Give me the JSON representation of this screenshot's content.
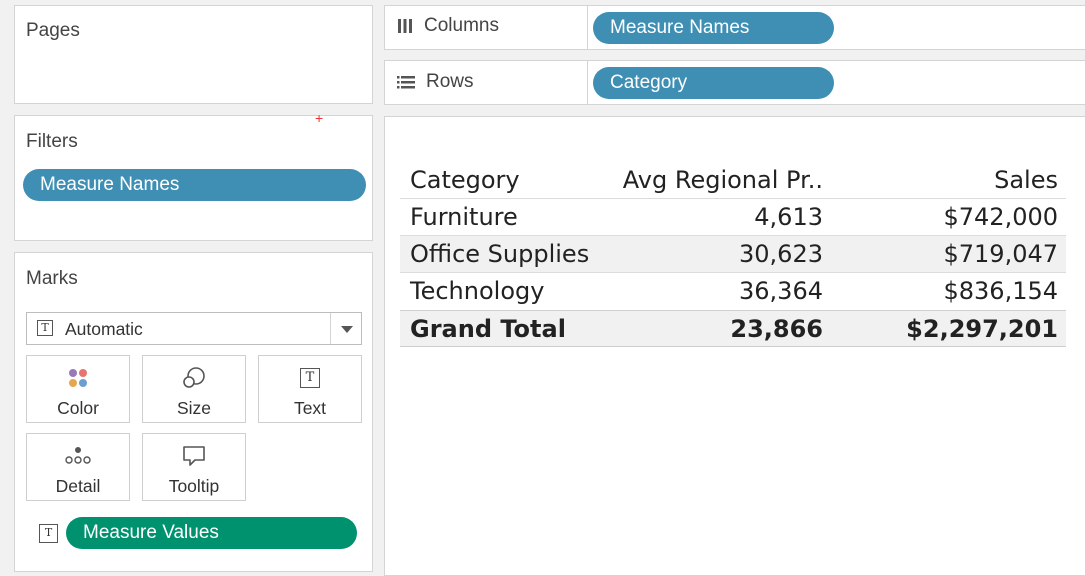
{
  "pages": {
    "title": "Pages"
  },
  "filters": {
    "title": "Filters",
    "pill": "Measure Names"
  },
  "marks": {
    "title": "Marks",
    "type_dropdown": "Automatic",
    "cards": [
      {
        "label": "Color",
        "icon": "color-dots-icon"
      },
      {
        "label": "Size",
        "icon": "size-icon"
      },
      {
        "label": "Text",
        "icon": "text-icon"
      },
      {
        "label": "Detail",
        "icon": "detail-icon"
      },
      {
        "label": "Tooltip",
        "icon": "tooltip-icon"
      }
    ],
    "field_pill": "Measure Values",
    "field_icon": "T"
  },
  "shelves": {
    "columns_label": "Columns",
    "columns_pill": "Measure Names",
    "rows_label": "Rows",
    "rows_pill": "Category"
  },
  "colors": {
    "dimension_pill": "#3f8fb5",
    "measure_pill": "#00926e"
  },
  "table": {
    "headers": [
      "Category",
      "Avg Regional Pr..",
      "Sales"
    ],
    "rows": [
      [
        "Furniture",
        "4,613",
        "$742,000"
      ],
      [
        "Office Supplies",
        "30,623",
        "$719,047"
      ],
      [
        "Technology",
        "36,364",
        "$836,154"
      ]
    ],
    "total": [
      "Grand Total",
      "23,866",
      "$2,297,201"
    ]
  }
}
